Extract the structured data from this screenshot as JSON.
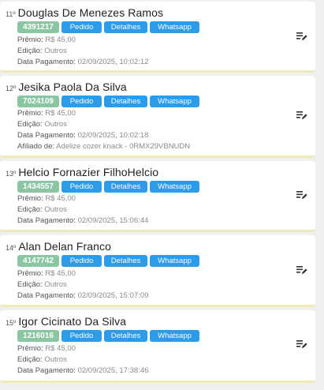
{
  "actions": {
    "pedido": "Pedido",
    "detalhes": "Detalhes",
    "whatsapp": "Whatsapp"
  },
  "labels": {
    "premio": "Prêmio:",
    "edicao": "Edição:",
    "data_pagamento": "Data Pagamento:",
    "afiliado": "Afiliado de:"
  },
  "icons": {
    "edit": "edit-list-icon"
  },
  "colors": {
    "code_badge": "#89c6a1",
    "action_button": "#2c9bea"
  },
  "entries": [
    {
      "rank": "11º",
      "name": "Douglas De Menezes Ramos",
      "code": "4391217",
      "premio": "R$ 45,00",
      "edicao": "Outros",
      "data_pagamento": "02/09/2025, 10:02:12"
    },
    {
      "rank": "12º",
      "name": "Jesika Paola Da Silva",
      "code": "7024109",
      "premio": "R$ 45,00",
      "edicao": "Outros",
      "data_pagamento": "02/09/2025, 10:02:18",
      "afiliado": "Adelize cozer knack - 0RMX29VBNUDN"
    },
    {
      "rank": "13º",
      "name": "Helcio Fornazier FilhoHelcio",
      "code": "1434557",
      "premio": "R$ 45,00",
      "edicao": "Outros",
      "data_pagamento": "02/09/2025, 15:06:44"
    },
    {
      "rank": "14º",
      "name": "Alan Delan Franco",
      "code": "4147742",
      "premio": "R$ 45,00",
      "edicao": "Outros",
      "data_pagamento": "02/09/2025, 15:07:09"
    },
    {
      "rank": "15º",
      "name": "Igor Cicinato Da Silva",
      "code": "1216016",
      "premio": "R$ 45,00",
      "edicao": "Outros",
      "data_pagamento": "02/09/2025, 17:38:46"
    }
  ]
}
